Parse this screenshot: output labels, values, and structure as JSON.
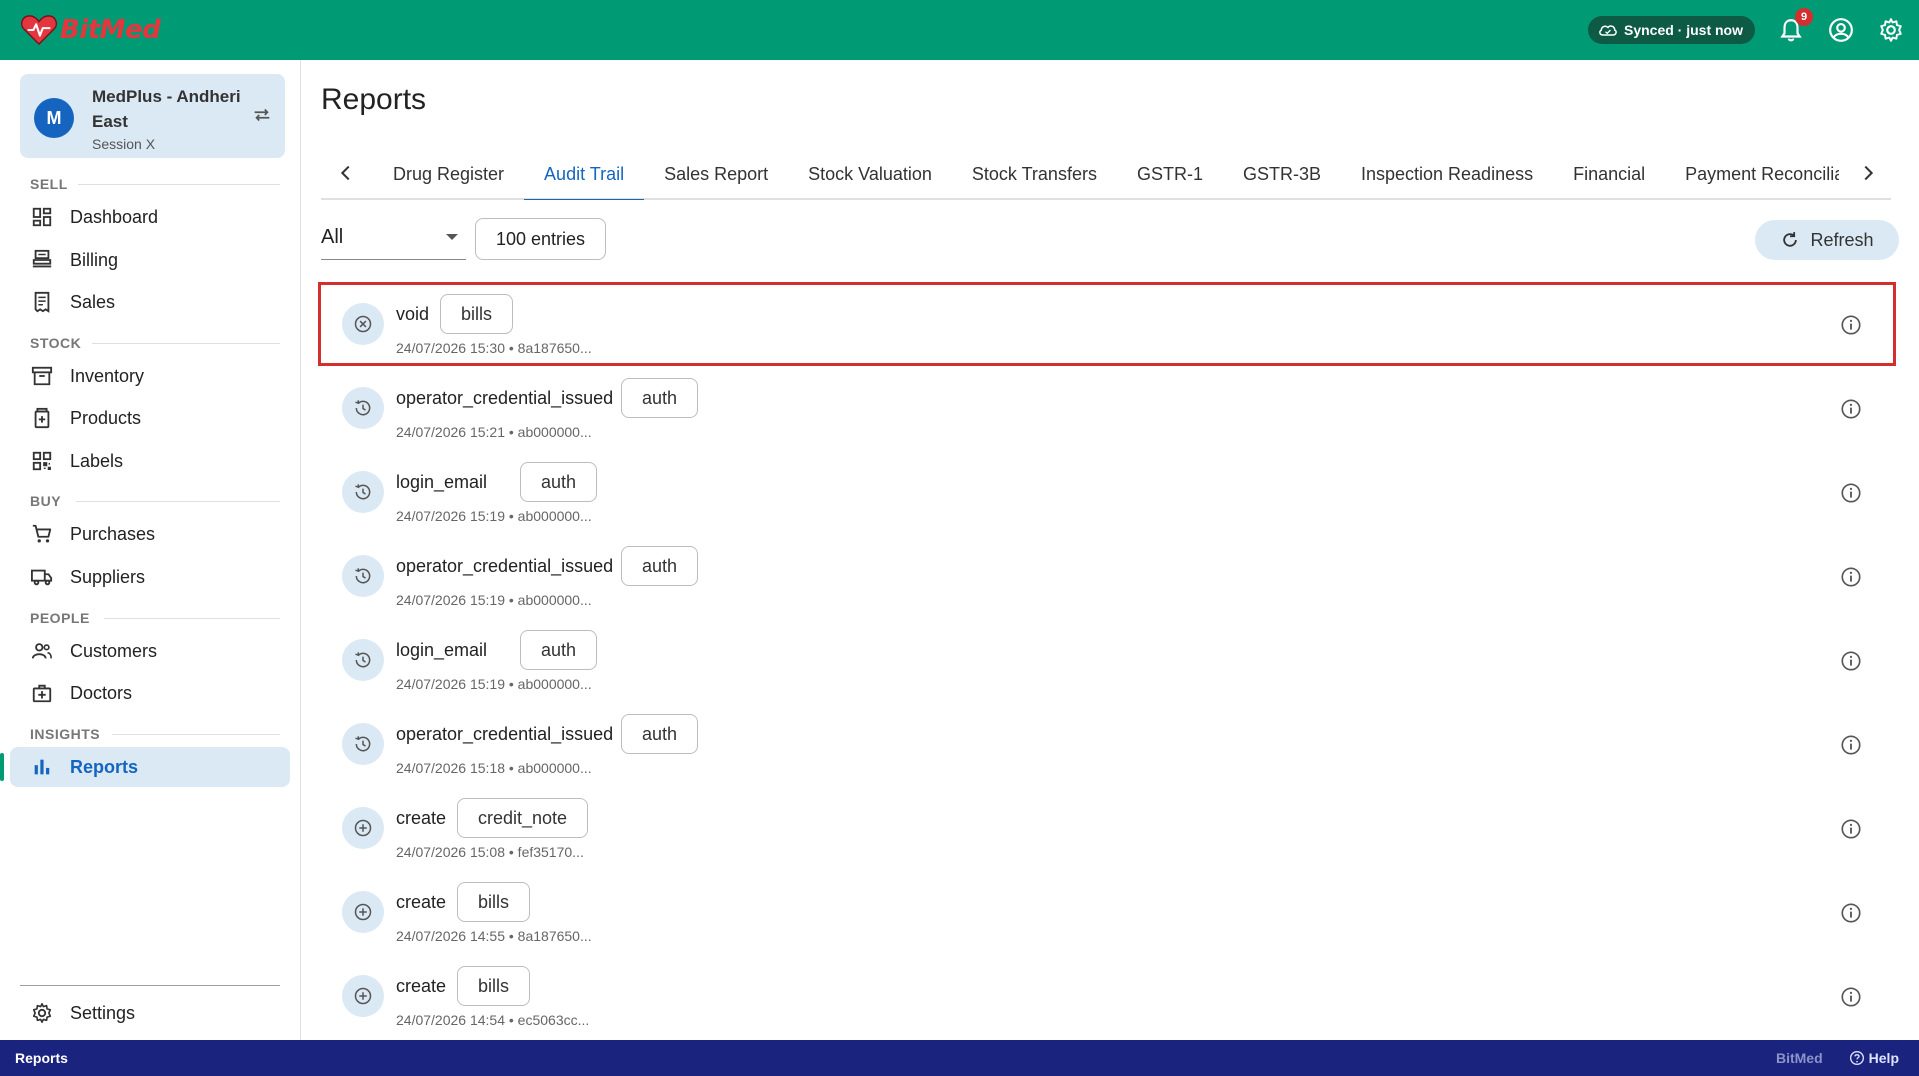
{
  "app": {
    "brand": "BitMed",
    "accent": "#009a74",
    "brand_red": "#e3363f"
  },
  "topbar": {
    "sync_status": "Synced · just now",
    "notification_count": "9",
    "icons": [
      "cloud-sync-icon",
      "bell-icon",
      "account-icon",
      "gear-icon"
    ]
  },
  "store": {
    "avatar_letter": "M",
    "name": "MedPlus - Andheri East",
    "session": "Session X"
  },
  "sidebar": {
    "sections": {
      "sell": "SELL",
      "stock": "STOCK",
      "buy": "BUY",
      "people": "PEOPLE",
      "insights": "INSIGHTS"
    },
    "items": [
      {
        "label": "Dashboard",
        "icon": "dashboard-icon"
      },
      {
        "label": "Billing",
        "icon": "billing-icon"
      },
      {
        "label": "Sales",
        "icon": "receipt-icon"
      },
      {
        "label": "Inventory",
        "icon": "inventory-icon"
      },
      {
        "label": "Products",
        "icon": "medicine-box-icon"
      },
      {
        "label": "Labels",
        "icon": "qr-code-icon"
      },
      {
        "label": "Purchases",
        "icon": "cart-icon"
      },
      {
        "label": "Suppliers",
        "icon": "truck-icon"
      },
      {
        "label": "Customers",
        "icon": "people-icon"
      },
      {
        "label": "Doctors",
        "icon": "medical-bag-icon"
      },
      {
        "label": "Reports",
        "icon": "bar-chart-icon",
        "active": true
      }
    ],
    "settings_label": "Settings"
  },
  "main": {
    "title": "Reports",
    "tabs": [
      "Drug Register",
      "Audit Trail",
      "Sales Report",
      "Stock Valuation",
      "Stock Transfers",
      "GSTR-1",
      "GSTR-3B",
      "Inspection Readiness",
      "Financial",
      "Payment Reconciliation"
    ],
    "active_tab": "Audit Trail",
    "filter": {
      "selected": "All"
    },
    "entries_label": "100 entries",
    "refresh_label": "Refresh",
    "audit_rows": [
      {
        "action": "void",
        "entity": "bills",
        "meta": "24/07/2026 15:30 • 8a187650...",
        "icon": "void-icon",
        "highlighted": true
      },
      {
        "action": "operator_credential_issued",
        "entity": "auth",
        "meta": "24/07/2026 15:21 • ab000000...",
        "icon": "history-icon"
      },
      {
        "action": "login_email",
        "entity": "auth",
        "meta": "24/07/2026 15:19 • ab000000...",
        "icon": "history-icon"
      },
      {
        "action": "operator_credential_issued",
        "entity": "auth",
        "meta": "24/07/2026 15:19 • ab000000...",
        "icon": "history-icon"
      },
      {
        "action": "login_email",
        "entity": "auth",
        "meta": "24/07/2026 15:19 • ab000000...",
        "icon": "history-icon"
      },
      {
        "action": "operator_credential_issued",
        "entity": "auth",
        "meta": "24/07/2026 15:18 • ab000000...",
        "icon": "history-icon"
      },
      {
        "action": "create",
        "entity": "credit_note",
        "meta": "24/07/2026 15:08 • fef35170...",
        "icon": "add-circle-icon"
      },
      {
        "action": "create",
        "entity": "bills",
        "meta": "24/07/2026 14:55 • 8a187650...",
        "icon": "add-circle-icon"
      },
      {
        "action": "create",
        "entity": "bills",
        "meta": "24/07/2026 14:54 • ec5063cc...",
        "icon": "add-circle-icon"
      }
    ]
  },
  "statusbar": {
    "left": "Reports",
    "brand": "BitMed",
    "help": "Help"
  }
}
